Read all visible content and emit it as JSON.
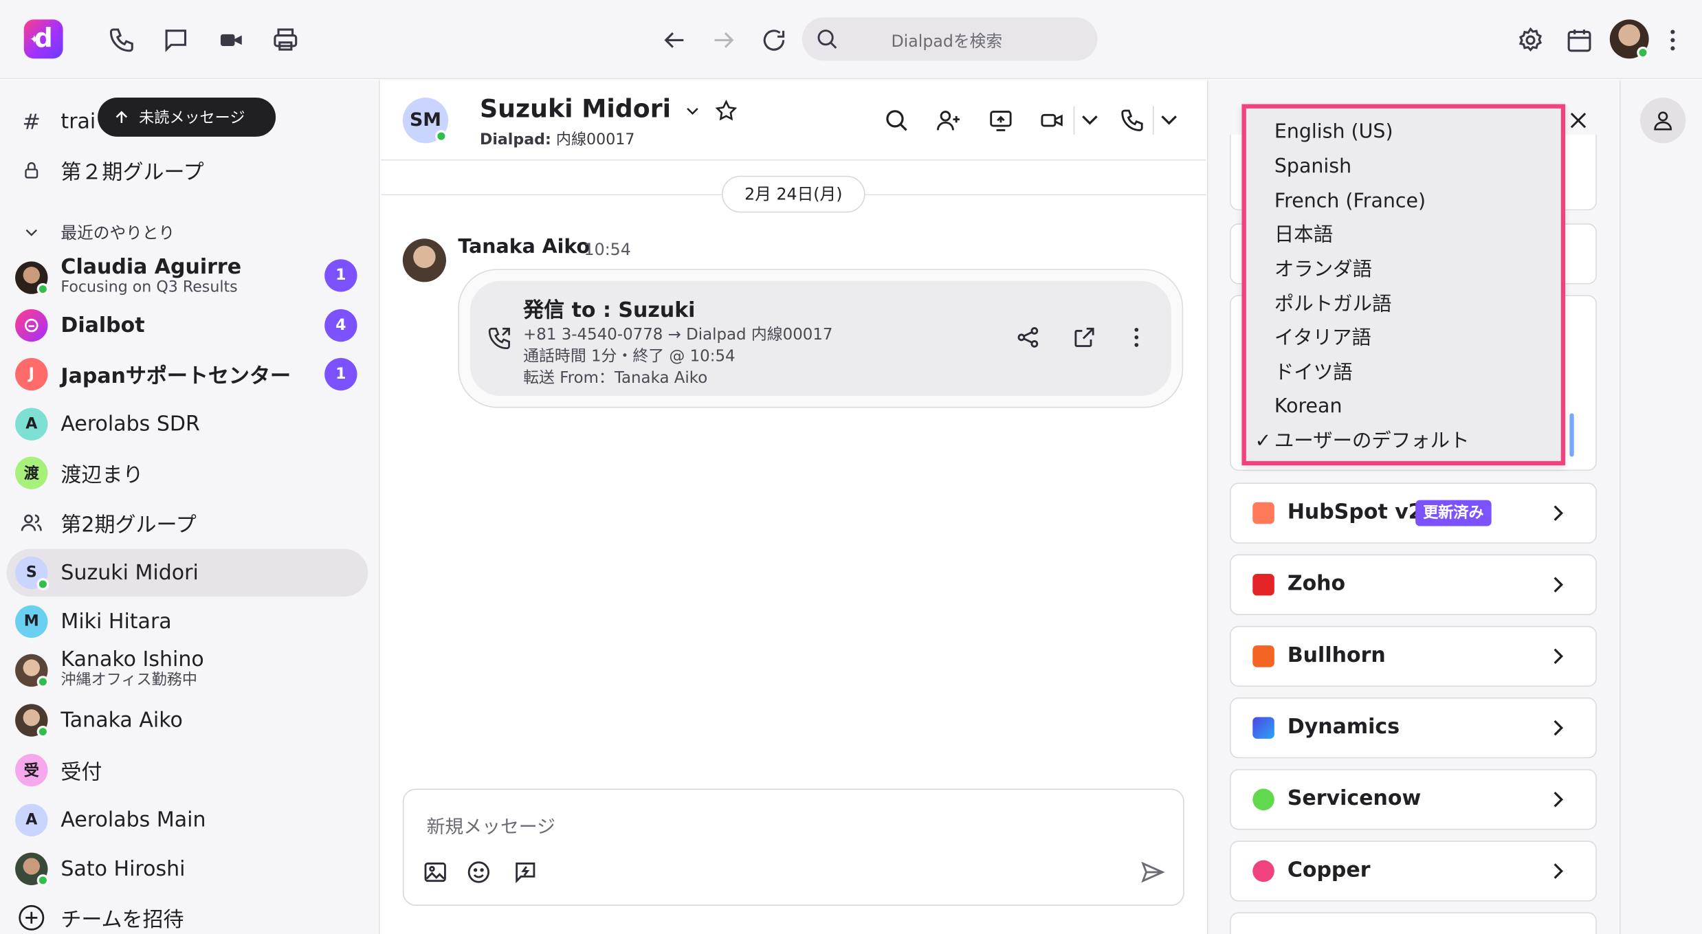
{
  "topbar": {
    "logo_letter": "d",
    "search_placeholder": "Dialpadを検索"
  },
  "sidebar": {
    "channel_partial": "trai",
    "unread_tooltip": "未読メッセージ",
    "group_locked": "第２期グループ",
    "recent_header": "最近のやりとり",
    "items": [
      {
        "name": "Claudia Aguirre",
        "status": "Focusing on Q3 Results",
        "badge": "1",
        "bold": true
      },
      {
        "name": "Dialbot",
        "badge": "4",
        "bold": true
      },
      {
        "name": "Japanサポートセンター",
        "initial": "J",
        "badge": "1",
        "bold": true
      },
      {
        "name": "Aerolabs SDR",
        "initial": "A"
      },
      {
        "name": "渡辺まり",
        "initial": "渡"
      },
      {
        "name": "第2期グループ"
      },
      {
        "name": "Suzuki Midori",
        "initial": "S"
      },
      {
        "name": "Miki Hitara",
        "initial": "M"
      },
      {
        "name": "Kanako Ishino",
        "status": "沖縄オフィス勤務中"
      },
      {
        "name": "Tanaka Aiko"
      },
      {
        "name": "受付",
        "initial": "受"
      },
      {
        "name": "Aerolabs Main",
        "initial": "A"
      },
      {
        "name": "Sato Hiroshi"
      },
      {
        "name": "チームを招待"
      }
    ]
  },
  "conversation": {
    "initials": "SM",
    "name": "Suzuki Midori",
    "sub_label": "Dialpad:",
    "sub_value": "内線00017",
    "date_pill": "2月 24日(月)",
    "message": {
      "sender": "Tanaka Aiko",
      "time": "10:54",
      "card_title": "発信 to : Suzuki",
      "line1": "+81 3-4540-0778 → Dialpad 内線00017",
      "line2": "通話時間 1分・終了 @ 10:54",
      "line3": "転送 From：Tanaka Aiko"
    },
    "composer_placeholder": "新規メッセージ"
  },
  "integrations": [
    {
      "name": "HubSpot v2",
      "badge": "更新済み",
      "icon": "hubspot-icon",
      "color": "#ff7a59"
    },
    {
      "name": "Zoho",
      "icon": "zoho-icon",
      "color": "#e42527"
    },
    {
      "name": "Bullhorn",
      "icon": "bullhorn-icon",
      "color": "#f26522"
    },
    {
      "name": "Dynamics",
      "icon": "dynamics-icon",
      "color": "#4f46e5"
    },
    {
      "name": "Servicenow",
      "icon": "servicenow-icon",
      "color": "#62d84e"
    },
    {
      "name": "Copper",
      "icon": "copper-icon",
      "color": "#f0427e"
    }
  ],
  "language_dropdown": {
    "options": [
      "English (US)",
      "Spanish",
      "French (France)",
      "日本語",
      "オランダ語",
      "ポルトガル語",
      "イタリア語",
      "ドイツ語",
      "Korean",
      "ユーザーのデフォルト"
    ],
    "selected": "ユーザーのデフォルト",
    "check": "✓"
  },
  "colors": {
    "accent": "#7c52ff",
    "highlight_border": "#f0427e",
    "online": "#2fbf4a"
  }
}
